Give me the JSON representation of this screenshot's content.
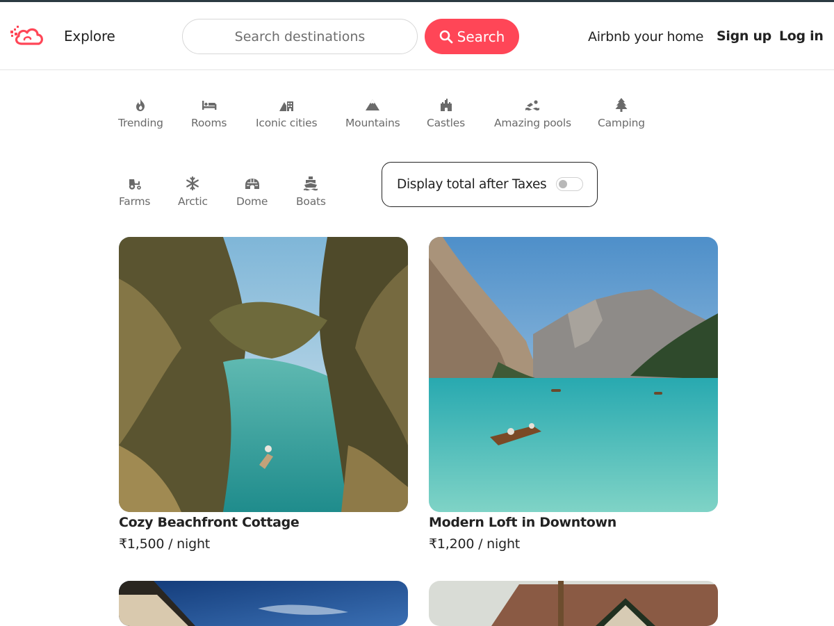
{
  "header": {
    "explore_label": "Explore",
    "search": {
      "placeholder": "Search destinations",
      "button_label": "Search"
    },
    "nav": {
      "host_label": "Airbnb your home",
      "signup_label": "Sign up",
      "login_label": "Log in"
    }
  },
  "categories": [
    {
      "label": "Trending",
      "icon": "fire-icon"
    },
    {
      "label": "Rooms",
      "icon": "bed-icon"
    },
    {
      "label": "Iconic cities",
      "icon": "city-icon"
    },
    {
      "label": "Mountains",
      "icon": "mountain-icon"
    },
    {
      "label": "Castles",
      "icon": "castle-icon"
    },
    {
      "label": "Amazing pools",
      "icon": "swimmer-icon"
    },
    {
      "label": "Camping",
      "icon": "tree-icon"
    },
    {
      "label": "Farms",
      "icon": "tractor-icon"
    },
    {
      "label": "Arctic",
      "icon": "snowflake-icon"
    },
    {
      "label": "Dome",
      "icon": "igloo-icon"
    },
    {
      "label": "Boats",
      "icon": "ship-icon"
    }
  ],
  "tax_toggle": {
    "label": "Display total after Taxes",
    "enabled": false
  },
  "listings": [
    {
      "title": "Cozy Beachfront Cottage",
      "price": "₹1,500 / night"
    },
    {
      "title": "Modern Loft in Downtown",
      "price": "₹1,200 / night"
    },
    {
      "title": "",
      "price": ""
    },
    {
      "title": "",
      "price": ""
    }
  ],
  "colors": {
    "accent": "#ff4657",
    "text": "#222222",
    "muted": "#6a6a6a"
  }
}
